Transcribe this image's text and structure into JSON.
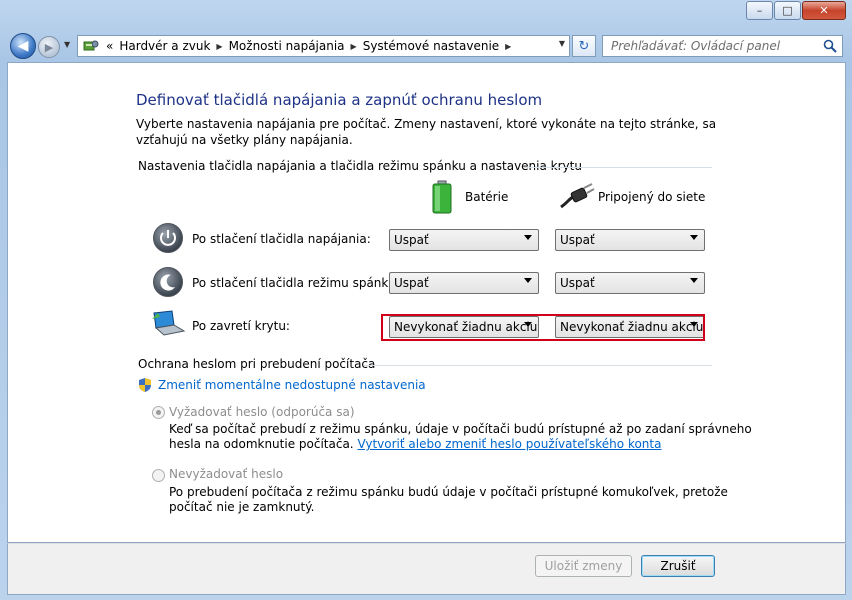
{
  "window": {
    "minimize_label": "–",
    "maximize_label": "□",
    "close_label": "✕"
  },
  "nav": {
    "back_label": "◀",
    "forward_label": "▶",
    "history_label": "▼",
    "breadcrumb_prefix": "«",
    "breadcrumb": [
      "Hardvér a zvuk",
      "Možnosti napájania",
      "Systémové nastavenie"
    ],
    "sep": "▶",
    "dropdown_label": "▼",
    "refresh_label": "↻",
    "search_placeholder": "Prehľadávať: Ovládací panel"
  },
  "page": {
    "title": "Definovať tlačidlá napájania a zapnúť ochranu heslom",
    "description": "Vyberte nastavenia napájania pre počítač. Zmeny nastavení, ktoré vykonáte na tejto stránke, sa vzťahujú na všetky plány napájania.",
    "buttons_group": "Nastavenia tlačidla napájania a tlačidla režimu spánku a nastavenia krytu",
    "col_battery": "Batérie",
    "col_plugged": "Pripojený do siete",
    "rows": [
      {
        "label": "Po stlačení tlačidla napájania:",
        "battery": "Uspať",
        "plugged": "Uspať"
      },
      {
        "label": "Po stlačení tlačidla režimu spánku:",
        "battery": "Uspať",
        "plugged": "Uspať"
      },
      {
        "label": "Po zavretí krytu:",
        "battery": "Nevykonať žiadnu akciu",
        "plugged": "Nevykonať žiadnu akciu"
      }
    ],
    "password_group": "Ochrana heslom pri prebudení počítača",
    "change_settings_link": "Zmeniť momentálne nedostupné nastavenia",
    "option_require": "Vyžadovať heslo (odporúča sa)",
    "option_require_desc": "Keď sa počítač prebudí z režimu spánku, údaje v počítači budú prístupné až po zadaní správneho",
    "option_require_desc2": "hesla na odomknutie počítača.",
    "option_require_link": "Vytvoriť alebo zmeniť heslo používateľského konta",
    "option_norequire": "Nevyžadovať heslo",
    "option_norequire_desc": "Po prebudení počítača z režimu spánku budú údaje v počítači prístupné komukoľvek, pretože",
    "option_norequire_desc2": "počítač nie je zamknutý."
  },
  "footer": {
    "save_label": "Uložiť zmeny",
    "cancel_label": "Zrušiť"
  },
  "colors": {
    "title": "#1e3287",
    "link": "#0066cc",
    "highlight_box": "#d0001a"
  }
}
